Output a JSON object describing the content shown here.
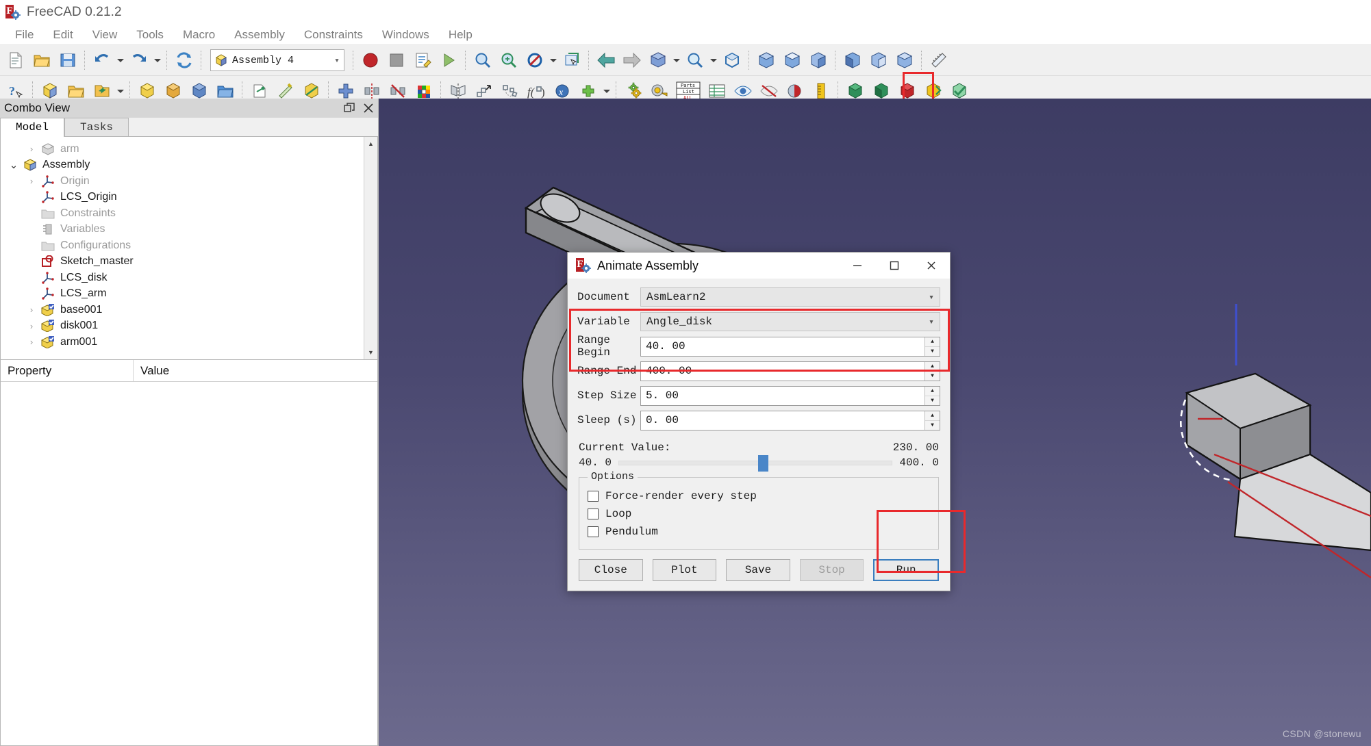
{
  "window": {
    "title": "FreeCAD 0.21.2",
    "logo_icon": "freecad-logo-icon"
  },
  "menubar": {
    "items": [
      {
        "label": "File"
      },
      {
        "label": "Edit"
      },
      {
        "label": "View"
      },
      {
        "label": "Tools"
      },
      {
        "label": "Macro"
      },
      {
        "label": "Assembly"
      },
      {
        "label": "Constraints"
      },
      {
        "label": "Windows"
      },
      {
        "label": "Help"
      }
    ]
  },
  "toolbar": {
    "workbench": {
      "value": "Assembly 4",
      "icon": "assembly-cube-icon",
      "chevron": "chevron-down-icon"
    }
  },
  "combo_view": {
    "header": "Combo View",
    "float_icon": "float-window-icon",
    "close_icon": "close-icon",
    "tabs": [
      {
        "label": "Model",
        "active": true
      },
      {
        "label": "Tasks",
        "active": false
      }
    ],
    "tree": [
      {
        "label": "arm",
        "icon": "part-icon",
        "indent": 1,
        "chevron": "collapsed",
        "dim": true
      },
      {
        "label": "Assembly",
        "icon": "assembly-icon",
        "indent": 0,
        "chevron": "expanded",
        "dim": false
      },
      {
        "label": "Origin",
        "icon": "lcs-icon",
        "indent": 1,
        "chevron": "collapsed",
        "dim": true
      },
      {
        "label": "LCS_Origin",
        "icon": "lcs-icon",
        "indent": 1,
        "chevron": "none",
        "dim": false
      },
      {
        "label": "Constraints",
        "icon": "folder-icon",
        "indent": 1,
        "chevron": "none",
        "dim": true
      },
      {
        "label": "Variables",
        "icon": "variables-icon",
        "indent": 1,
        "chevron": "none",
        "dim": true
      },
      {
        "label": "Configurations",
        "icon": "folder-icon",
        "indent": 1,
        "chevron": "none",
        "dim": true
      },
      {
        "label": "Sketch_master",
        "icon": "sketch-icon",
        "indent": 1,
        "chevron": "none",
        "dim": false
      },
      {
        "label": "LCS_disk",
        "icon": "lcs-icon",
        "indent": 1,
        "chevron": "none",
        "dim": false
      },
      {
        "label": "LCS_arm",
        "icon": "lcs-icon",
        "indent": 1,
        "chevron": "none",
        "dim": false
      },
      {
        "label": "base001",
        "icon": "linked-part-icon",
        "indent": 1,
        "chevron": "collapsed",
        "dim": false
      },
      {
        "label": "disk001",
        "icon": "linked-part-icon",
        "indent": 1,
        "chevron": "collapsed",
        "dim": false
      },
      {
        "label": "arm001",
        "icon": "linked-part-icon",
        "indent": 1,
        "chevron": "collapsed",
        "dim": false
      }
    ],
    "property_editor": {
      "columns": [
        "Property",
        "Value"
      ],
      "rows": []
    }
  },
  "view3d": {
    "watermark": "CSDN @stonewu"
  },
  "dialog": {
    "title": "Animate Assembly",
    "icon": "freecad-logo-icon",
    "controls": {
      "minimize": "minimize-icon",
      "maximize": "maximize-icon",
      "close": "close-icon"
    },
    "fields": {
      "document": {
        "label": "Document",
        "value": "AsmLearn2",
        "chevron": "chevron-down-icon"
      },
      "variable": {
        "label": "Variable",
        "value": "Angle_disk",
        "chevron": "chevron-down-icon"
      },
      "range_begin": {
        "label": "Range Begin",
        "value": "40. 00"
      },
      "range_end": {
        "label": "Range End",
        "value": "400. 00"
      },
      "step_size": {
        "label": "Step Size",
        "value": "5. 00"
      },
      "sleep": {
        "label": "Sleep (s)",
        "value": "0. 00"
      }
    },
    "current_value": {
      "label": "Current Value:",
      "value": "230. 00",
      "slider_min": "40. 0",
      "slider_max": "400. 0",
      "slider_percent": 52.8
    },
    "options": {
      "title": "Options",
      "items": [
        {
          "label": "Force-render every step",
          "checked": false
        },
        {
          "label": "Loop",
          "checked": false
        },
        {
          "label": "Pendulum",
          "checked": false
        }
      ]
    },
    "buttons": [
      {
        "label": "Close",
        "state": "normal"
      },
      {
        "label": "Plot",
        "state": "normal"
      },
      {
        "label": "Save",
        "state": "normal"
      },
      {
        "label": "Stop",
        "state": "disabled"
      },
      {
        "label": "Run",
        "state": "default"
      }
    ]
  },
  "highlights": {
    "accent": "#e8292c"
  }
}
